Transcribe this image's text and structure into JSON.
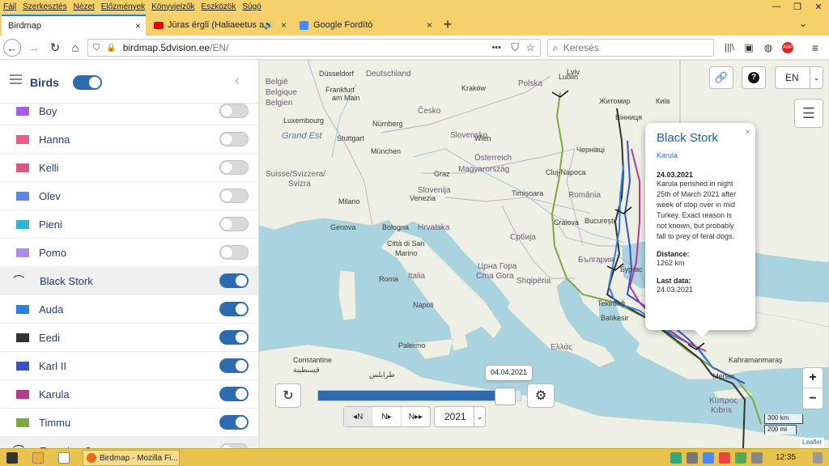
{
  "menubar": {
    "items": [
      "Fájl",
      "Szerkesztés",
      "Nézet",
      "Előzmények",
      "Könyvjelzők",
      "Eszközök",
      "Súgó"
    ]
  },
  "tabs": [
    {
      "label": "Birdmap",
      "active": true
    },
    {
      "label": "Jūras ērglī (Haliaeetus albic",
      "active": false
    },
    {
      "label": "Google Fordító",
      "active": false
    }
  ],
  "nav": {
    "url": "birdmap.5dvision.ee/EN/",
    "url_host": "birdmap.5dvision.ee",
    "url_path": "/EN/",
    "search_placeholder": "Keresés",
    "dots": "•••"
  },
  "sidebar": {
    "title": "Birds",
    "rows": [
      {
        "type": "bird",
        "label": "Boy",
        "color": "#a45ee8",
        "on": false
      },
      {
        "type": "bird",
        "label": "Hanna",
        "color": "#ee5c86",
        "on": false
      },
      {
        "type": "bird",
        "label": "Kelli",
        "color": "#d65c7e",
        "on": false
      },
      {
        "type": "bird",
        "label": "Olev",
        "color": "#5b86e8",
        "on": false
      },
      {
        "type": "bird",
        "label": "Pieni",
        "color": "#33b3d6",
        "on": false
      },
      {
        "type": "bird",
        "label": "Pomo",
        "color": "#b38be8",
        "on": false
      },
      {
        "type": "group",
        "label": "Black Stork",
        "on": true
      },
      {
        "type": "bird",
        "label": "Auda",
        "color": "#2f7fe6",
        "on": true
      },
      {
        "type": "bird",
        "label": "Eedi",
        "color": "#333333",
        "on": true
      },
      {
        "type": "bird",
        "label": "Karl II",
        "color": "#3b4fc8",
        "on": true
      },
      {
        "type": "bird",
        "label": "Karula",
        "color": "#b43a8a",
        "on": true
      },
      {
        "type": "bird",
        "label": "Timmu",
        "color": "#7da83a",
        "on": true
      },
      {
        "type": "group",
        "label": "Eurasian Crane",
        "on": false
      }
    ]
  },
  "map": {
    "lang": "EN",
    "date_label": "04.04.2021",
    "year": "2021",
    "scale_km": "300 km",
    "scale_mi": "200 mi",
    "attribution": "Leaflet",
    "zoom_in": "+",
    "zoom_out": "−",
    "slider_progress": 0.88,
    "labels": [
      {
        "t": "België",
        "c": "country"
      },
      {
        "t": "Belgique",
        "c": "country"
      },
      {
        "t": "Belgien",
        "c": "country"
      },
      {
        "t": "Luxembourg",
        "c": ""
      },
      {
        "t": "Grand Est",
        "c": "sea"
      },
      {
        "t": "Suisse/Svizzera/",
        "c": "country"
      },
      {
        "t": "Svizra",
        "c": "country"
      },
      {
        "t": "Düsseldorf",
        "c": ""
      },
      {
        "t": "Deutschland",
        "c": "country"
      },
      {
        "t": "Frankfurt",
        "c": ""
      },
      {
        "t": "am Main",
        "c": ""
      },
      {
        "t": "Nürnberg",
        "c": ""
      },
      {
        "t": "Stuttgart",
        "c": ""
      },
      {
        "t": "München",
        "c": ""
      },
      {
        "t": "Česko",
        "c": "country"
      },
      {
        "t": "Slovensko",
        "c": "country"
      },
      {
        "t": "Wien",
        "c": ""
      },
      {
        "t": "Österreich",
        "c": "country"
      },
      {
        "t": "Graz",
        "c": ""
      },
      {
        "t": "Magyarország",
        "c": "country"
      },
      {
        "t": "Slovenija",
        "c": "country"
      },
      {
        "t": "Milano",
        "c": ""
      },
      {
        "t": "Venezia",
        "c": ""
      },
      {
        "t": "Genova",
        "c": ""
      },
      {
        "t": "Bologna",
        "c": ""
      },
      {
        "t": "Hrvatska",
        "c": "country"
      },
      {
        "t": "Città di San",
        "c": ""
      },
      {
        "t": "Marino",
        "c": ""
      },
      {
        "t": "Italia",
        "c": "country"
      },
      {
        "t": "Roma",
        "c": ""
      },
      {
        "t": "Napoli",
        "c": ""
      },
      {
        "t": "Palermo",
        "c": ""
      },
      {
        "t": "Constantine",
        "c": ""
      },
      {
        "t": "قسنطينة",
        "c": ""
      },
      {
        "t": "طرابلس",
        "c": ""
      },
      {
        "t": "Србија",
        "c": "country"
      },
      {
        "t": "Црна Гора",
        "c": "country"
      },
      {
        "t": "Crna Gora",
        "c": "country"
      },
      {
        "t": "Shqipëria",
        "c": "country"
      },
      {
        "t": "România",
        "c": "country"
      },
      {
        "t": "Cluj-Napoca",
        "c": ""
      },
      {
        "t": "Timișoara",
        "c": ""
      },
      {
        "t": "Craiova",
        "c": ""
      },
      {
        "t": "București",
        "c": ""
      },
      {
        "t": "България",
        "c": "country"
      },
      {
        "t": "Ελλάς",
        "c": "country"
      },
      {
        "t": "Житомир",
        "c": ""
      },
      {
        "t": "Київ",
        "c": ""
      },
      {
        "t": "Вінниця",
        "c": ""
      },
      {
        "t": "Чернівці",
        "c": ""
      },
      {
        "t": "Бургас",
        "c": ""
      },
      {
        "t": "Tekirdağ",
        "c": ""
      },
      {
        "t": "Balıkesir",
        "c": ""
      },
      {
        "t": "Mersin",
        "c": ""
      },
      {
        "t": "Kahramanmaraş",
        "c": ""
      },
      {
        "t": "Κύπρος",
        "c": "country"
      },
      {
        "t": "Kıbrıs",
        "c": "country"
      },
      {
        "t": "Lublin",
        "c": ""
      },
      {
        "t": "Kraków",
        "c": ""
      },
      {
        "t": "Lviv",
        "c": ""
      },
      {
        "t": "Polska",
        "c": "country"
      }
    ]
  },
  "popup": {
    "title": "Black Stork",
    "subtitle": "Karula",
    "date": "24.03.2021",
    "text": "Karula perished in night 25th of March 2021 after week of stop over in mid Turkey. Exact reason is not known, but probably fall to prey of feral dogs.",
    "distance_label": "Distance:",
    "distance_value": "1262 km",
    "last_label": "Last data:",
    "last_value": "24.03.2021",
    "close": "×"
  },
  "taskbar": {
    "app_label": "Birdmap - Mozilla Fi...",
    "clock": "12:35"
  },
  "colors": {
    "menubar": "#f5d06b",
    "toggle_on": "#2d6bb0",
    "map_water": "#a9d3df",
    "map_land": "#eef0e6"
  }
}
